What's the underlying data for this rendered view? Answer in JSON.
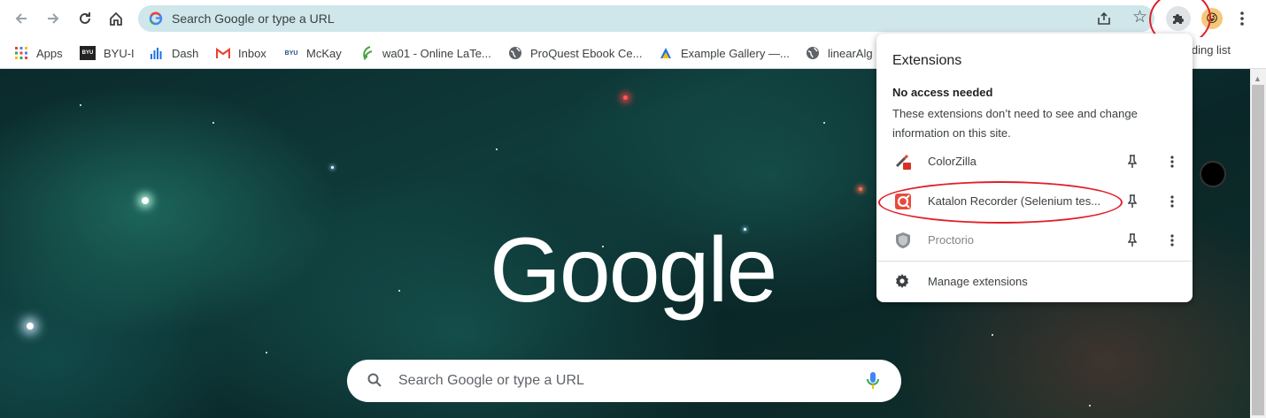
{
  "omnibox": {
    "placeholder": "Search Google or type a URL"
  },
  "bookmarks": [
    {
      "label": "Apps",
      "icon": "apps-grid-icon"
    },
    {
      "label": "BYU-I",
      "icon": "byui-logo-icon"
    },
    {
      "label": "Dash",
      "icon": "dash-bars-icon"
    },
    {
      "label": "Inbox",
      "icon": "gmail-icon"
    },
    {
      "label": "McKay",
      "icon": "byui-mckay-icon"
    },
    {
      "label": "wa01 - Online LaTe...",
      "icon": "overleaf-icon"
    },
    {
      "label": "ProQuest Ebook Ce...",
      "icon": "globe-icon"
    },
    {
      "label": "Example Gallery —...",
      "icon": "gallery-icon"
    },
    {
      "label": "linearAlg",
      "icon": "globe-icon"
    }
  ],
  "reading_list": {
    "label": "Reading list"
  },
  "extensions_popup": {
    "title": "Extensions",
    "section_title": "No access needed",
    "section_desc": "These extensions don’t need to see and change information on this site.",
    "items": [
      {
        "name": "ColorZilla",
        "icon": "colorzilla-icon"
      },
      {
        "name": "Katalon Recorder (Selenium tes...",
        "icon": "katalon-icon"
      },
      {
        "name": "Proctorio",
        "icon": "proctorio-shield-icon"
      }
    ],
    "manage_label": "Manage extensions"
  },
  "ntp": {
    "logo": "Google",
    "search_placeholder": "Search Google or type a URL"
  },
  "colors": {
    "omnibox_bg": "#cfe6ea",
    "annotation_red": "#e0202a",
    "google_blue": "#4285f4",
    "google_red": "#ea4335",
    "google_yellow": "#fbbc05",
    "google_green": "#34a853"
  }
}
